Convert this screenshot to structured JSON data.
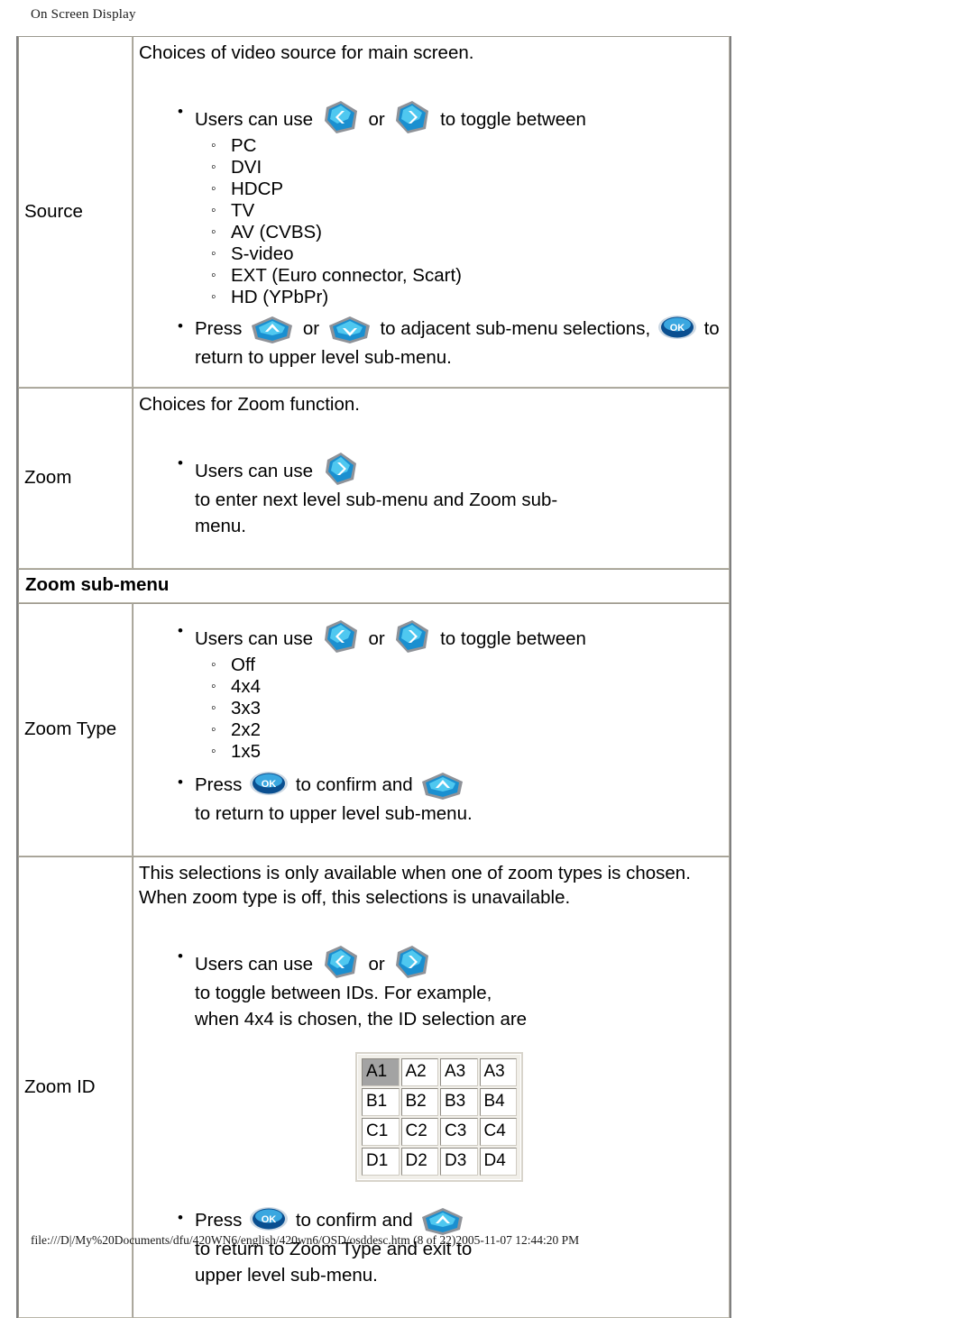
{
  "page": {
    "header": "On Screen Display",
    "footer": "file:///D|/My%20Documents/dfu/420WN6/english/420wn6/OSD/osddesc.htm (8 of 22)2005-11-07 12:44:20 PM"
  },
  "icons": {
    "left": "arrow-left-gem-icon",
    "right": "arrow-right-gem-icon",
    "up": "arrow-up-gem-icon",
    "down": "arrow-down-gem-icon",
    "ok": "ok-button-icon",
    "ok_label": "OK"
  },
  "colors": {
    "gem_light": "#4fc8f0",
    "gem_mid": "#1a8fd0",
    "gem_dark": "#0b5c96",
    "gem_outline": "#8f9298",
    "ok_light": "#3aa7e0",
    "ok_dark": "#0a4f90",
    "grid_selected": "#a3a3a3",
    "table_border": "#b9b5a8"
  },
  "rows": {
    "source": {
      "label": "Source",
      "intro": "Choices of video source for main screen.",
      "bullet1_pre": "Users can use",
      "bullet1_mid": "or",
      "bullet1_post": "to toggle between",
      "options": [
        "PC",
        "DVI",
        "HDCP",
        "TV",
        "AV (CVBS)",
        "S-video",
        "EXT (Euro connector, Scart)",
        "HD (YPbPr)"
      ],
      "bullet2_pre": "Press",
      "bullet2_mid": "or",
      "bullet2_post": "to adjacent sub-menu selections,",
      "bullet2_tail": "to",
      "bullet2_line2": "return to upper level sub-menu."
    },
    "zoom": {
      "label": "Zoom",
      "intro": "Choices for Zoom function.",
      "bullet1_pre": "Users can use",
      "bullet1_post": "to enter next level sub-menu and Zoom sub-",
      "bullet1_line2": "menu."
    },
    "zoom_submenu_heading": "Zoom sub-menu",
    "zoom_type": {
      "label": "Zoom Type",
      "bullet1_pre": "Users can use",
      "bullet1_mid": "or",
      "bullet1_post": "to toggle between",
      "options": [
        "Off",
        "4x4",
        "3x3",
        "2x2",
        "1x5"
      ],
      "bullet2_pre": "Press",
      "bullet2_mid": "to confirm and",
      "bullet2_post": "to return to upper level sub-menu."
    },
    "zoom_id": {
      "label": "Zoom ID",
      "intro_line1": "This selections is only available when one of zoom types is chosen.",
      "intro_line2": "When zoom type is off, this selections is unavailable.",
      "bullet1_pre": "Users can use",
      "bullet1_mid": "or",
      "bullet1_post": "to toggle between IDs. For example,",
      "bullet1_line2": "when 4x4 is chosen, the ID selection are",
      "grid": [
        [
          "A1",
          "A2",
          "A3",
          "A3"
        ],
        [
          "B1",
          "B2",
          "B3",
          "B4"
        ],
        [
          "C1",
          "C2",
          "C3",
          "C4"
        ],
        [
          "D1",
          "D2",
          "D3",
          "D4"
        ]
      ],
      "grid_selected": "A1",
      "bullet2_pre": "Press",
      "bullet2_mid": "to confirm and",
      "bullet2_post": "to return to Zoom Type and exit to",
      "bullet2_line2": "upper level sub-menu."
    }
  }
}
